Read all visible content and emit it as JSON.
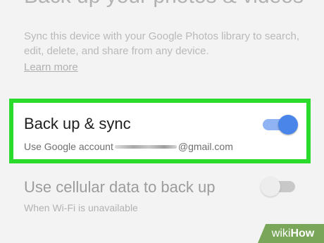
{
  "header": {
    "title": "Back up your photos & videos"
  },
  "description": {
    "text": "Sync this device with your Google Photos library to search, edit, delete, and share from any device.",
    "link": "Learn more"
  },
  "backup_setting": {
    "title": "Back up & sync",
    "account_prefix": "Use Google account",
    "account_suffix": "@gmail.com",
    "enabled": true
  },
  "cellular_setting": {
    "title": "Use cellular data to back up",
    "subtitle": "When Wi-Fi is unavailable",
    "enabled": false
  },
  "watermark": {
    "prefix": "wiki",
    "suffix": "How"
  },
  "colors": {
    "highlight_border": "#2bdb2b",
    "toggle_on_thumb": "#4a86ea",
    "toggle_on_track": "#8fb3f3",
    "toggle_off_thumb": "#ededed",
    "toggle_off_track": "#c8c8c8",
    "background": "#f3f3f3"
  }
}
